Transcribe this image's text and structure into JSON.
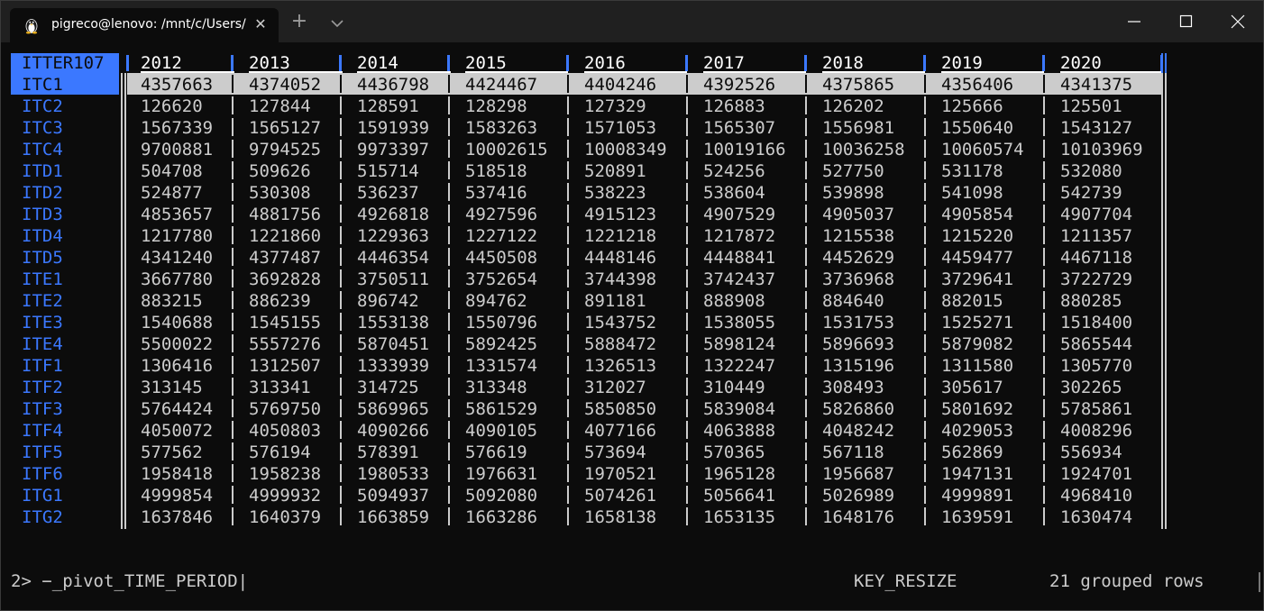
{
  "window": {
    "tab_title": "pigreco@lenovo: /mnt/c/Users/",
    "tab_icon": "linux-penguin-icon",
    "new_tab_label": "+",
    "close_tab_label": "✕"
  },
  "table": {
    "corner_label": "ITTER107",
    "columns": [
      "2012",
      "2013",
      "2014",
      "2015",
      "2016",
      "2017",
      "2018",
      "2019",
      "2020"
    ],
    "selected_row": 0,
    "rows": [
      {
        "label": "ITC1",
        "values": [
          "4357663",
          "4374052",
          "4436798",
          "4424467",
          "4404246",
          "4392526",
          "4375865",
          "4356406",
          "4341375"
        ]
      },
      {
        "label": "ITC2",
        "values": [
          "126620",
          "127844",
          "128591",
          "128298",
          "127329",
          "126883",
          "126202",
          "125666",
          "125501"
        ]
      },
      {
        "label": "ITC3",
        "values": [
          "1567339",
          "1565127",
          "1591939",
          "1583263",
          "1571053",
          "1565307",
          "1556981",
          "1550640",
          "1543127"
        ]
      },
      {
        "label": "ITC4",
        "values": [
          "9700881",
          "9794525",
          "9973397",
          "10002615",
          "10008349",
          "10019166",
          "10036258",
          "10060574",
          "10103969"
        ]
      },
      {
        "label": "ITD1",
        "values": [
          "504708",
          "509626",
          "515714",
          "518518",
          "520891",
          "524256",
          "527750",
          "531178",
          "532080"
        ]
      },
      {
        "label": "ITD2",
        "values": [
          "524877",
          "530308",
          "536237",
          "537416",
          "538223",
          "538604",
          "539898",
          "541098",
          "542739"
        ]
      },
      {
        "label": "ITD3",
        "values": [
          "4853657",
          "4881756",
          "4926818",
          "4927596",
          "4915123",
          "4907529",
          "4905037",
          "4905854",
          "4907704"
        ]
      },
      {
        "label": "ITD4",
        "values": [
          "1217780",
          "1221860",
          "1229363",
          "1227122",
          "1221218",
          "1217872",
          "1215538",
          "1215220",
          "1211357"
        ]
      },
      {
        "label": "ITD5",
        "values": [
          "4341240",
          "4377487",
          "4446354",
          "4450508",
          "4448146",
          "4448841",
          "4452629",
          "4459477",
          "4467118"
        ]
      },
      {
        "label": "ITE1",
        "values": [
          "3667780",
          "3692828",
          "3750511",
          "3752654",
          "3744398",
          "3742437",
          "3736968",
          "3729641",
          "3722729"
        ]
      },
      {
        "label": "ITE2",
        "values": [
          "883215",
          "886239",
          "896742",
          "894762",
          "891181",
          "888908",
          "884640",
          "882015",
          "880285"
        ]
      },
      {
        "label": "ITE3",
        "values": [
          "1540688",
          "1545155",
          "1553138",
          "1550796",
          "1543752",
          "1538055",
          "1531753",
          "1525271",
          "1518400"
        ]
      },
      {
        "label": "ITE4",
        "values": [
          "5500022",
          "5557276",
          "5870451",
          "5892425",
          "5888472",
          "5898124",
          "5896693",
          "5879082",
          "5865544"
        ]
      },
      {
        "label": "ITF1",
        "values": [
          "1306416",
          "1312507",
          "1333939",
          "1331574",
          "1326513",
          "1322247",
          "1315196",
          "1311580",
          "1305770"
        ]
      },
      {
        "label": "ITF2",
        "values": [
          "313145",
          "313341",
          "314725",
          "313348",
          "312027",
          "310449",
          "308493",
          "305617",
          "302265"
        ]
      },
      {
        "label": "ITF3",
        "values": [
          "5764424",
          "5769750",
          "5869965",
          "5861529",
          "5850850",
          "5839084",
          "5826860",
          "5801692",
          "5785861"
        ]
      },
      {
        "label": "ITF4",
        "values": [
          "4050072",
          "4050803",
          "4090266",
          "4090105",
          "4077166",
          "4063888",
          "4048242",
          "4029053",
          "4008296"
        ]
      },
      {
        "label": "ITF5",
        "values": [
          "577562",
          "576194",
          "578391",
          "576619",
          "573694",
          "570365",
          "567118",
          "562869",
          "556934"
        ]
      },
      {
        "label": "ITF6",
        "values": [
          "1958418",
          "1958238",
          "1980533",
          "1976631",
          "1970521",
          "1965128",
          "1956687",
          "1947131",
          "1924701"
        ]
      },
      {
        "label": "ITG1",
        "values": [
          "4999854",
          "4999932",
          "5094937",
          "5092080",
          "5074261",
          "5056641",
          "5026989",
          "4999891",
          "4968410"
        ]
      },
      {
        "label": "ITG2",
        "values": [
          "1637846",
          "1640379",
          "1663859",
          "1663286",
          "1658138",
          "1653135",
          "1648176",
          "1639591",
          "1630474"
        ]
      }
    ]
  },
  "status_bar": {
    "command": "2> −_pivot_TIME_PERIOD|",
    "key_event": "KEY_RESIZE",
    "row_count": "21 grouped rows"
  },
  "colors": {
    "background": "#0c0c0c",
    "titlebar": "#202020",
    "text": "#cccccc",
    "accent_blue": "#3b78ff",
    "header_text": "#ffffff",
    "selection_bg": "#cccccc"
  }
}
